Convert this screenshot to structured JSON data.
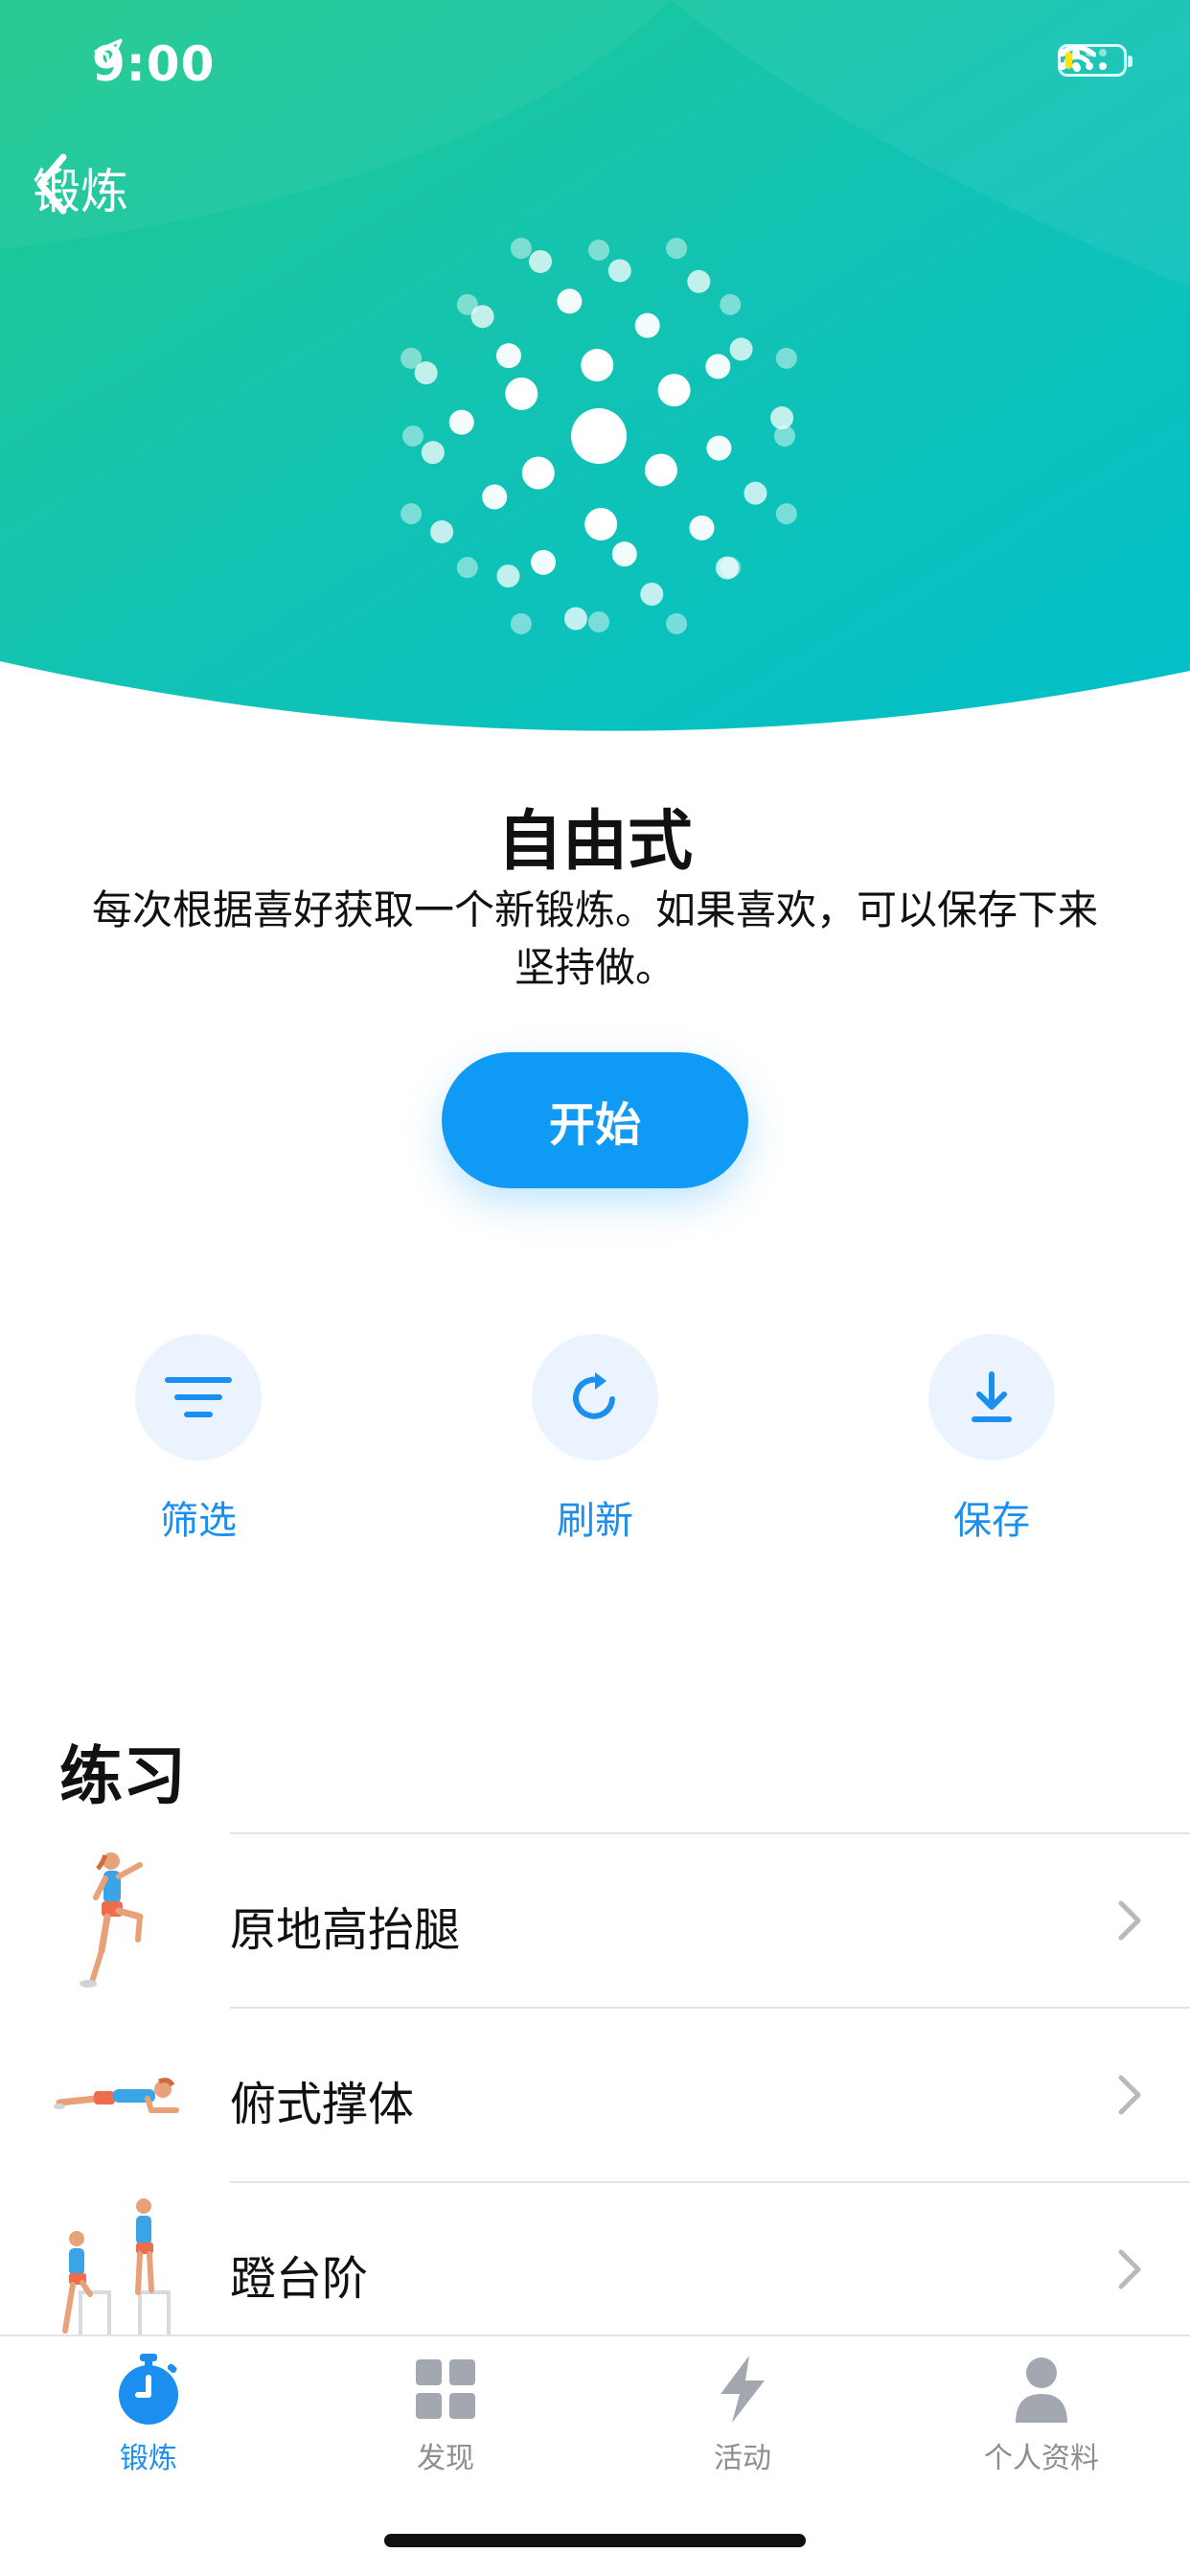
{
  "status_bar": {
    "time": "9:00",
    "icons": [
      "location-arrow-icon",
      "cellular-signal-icon",
      "wifi-icon",
      "battery-icon"
    ],
    "battery_level": 0.12,
    "battery_color": "#ffe21a"
  },
  "nav": {
    "back_label": "锻炼",
    "back_icon": "chevron-left-icon"
  },
  "header": {
    "gradient_colors": [
      "#1fc98c",
      "#12c3b4",
      "#00bfc8"
    ],
    "hero_icon": "dot-burst-icon"
  },
  "workout": {
    "title": "自由式",
    "description": "每次根据喜好获取一个新锻炼。如果喜欢，可以保存下来坚持做。",
    "start_label": "开始",
    "accent_color": "#0f9bf5"
  },
  "actions": [
    {
      "label": "筛选",
      "icon": "filter-icon"
    },
    {
      "label": "刷新",
      "icon": "refresh-icon"
    },
    {
      "label": "保存",
      "icon": "download-icon"
    }
  ],
  "exercises": {
    "title": "练习",
    "items": [
      {
        "name": "原地高抬腿",
        "thumb": "high-knees-figure"
      },
      {
        "name": "俯式撑体",
        "thumb": "plank-figure"
      },
      {
        "name": "蹬台阶",
        "thumb": "step-up-figure"
      }
    ]
  },
  "tabbar": {
    "items": [
      {
        "label": "锻炼",
        "icon": "stopwatch-icon",
        "active": true
      },
      {
        "label": "发现",
        "icon": "grid-icon",
        "active": false
      },
      {
        "label": "活动",
        "icon": "lightning-icon",
        "active": false
      },
      {
        "label": "个人资料",
        "icon": "person-icon",
        "active": false
      }
    ],
    "active_color": "#1a8ff0",
    "inactive_color": "#8d8d93"
  }
}
